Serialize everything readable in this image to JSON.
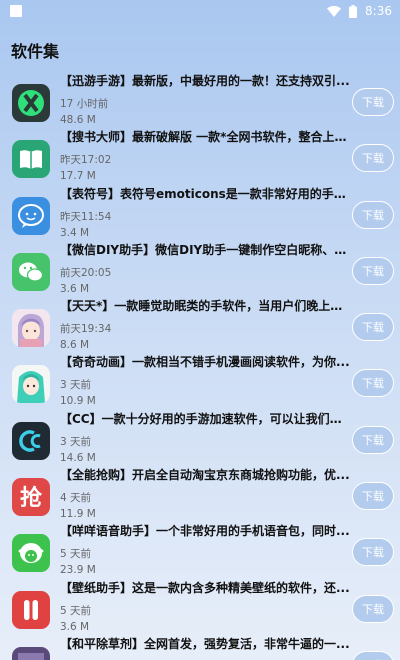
{
  "status_bar": {
    "time": "8:36"
  },
  "page": {
    "title": "软件集"
  },
  "download_label": "下载",
  "apps": [
    {
      "title": "【迅游手游】最新版，中最好用的一款！还支持双引...",
      "time": "17 小时前",
      "size": "48.6 M",
      "icon": "xunyou-app-icon"
    },
    {
      "title": "【搜书大师】最新破解版 一款*全网书软件，整合上百...",
      "time": "昨天17:02",
      "size": "17.7 M",
      "icon": "book-app-icon"
    },
    {
      "title": "【表符号】表符号emoticons是一款非常好用的手表符...",
      "time": "昨天11:54",
      "size": "3.4 M",
      "icon": "chat-bubble-app-icon"
    },
    {
      "title": "【微信DIY助手】微信DIY助手一键制作空白昵称、头...",
      "time": "前天20:05",
      "size": "3.6 M",
      "icon": "wechat-app-icon"
    },
    {
      "title": "【天天*】一款睡觉助眠类的手软件，当用户们晚上翻...",
      "time": "前天19:34",
      "size": "8.6 M",
      "icon": "anime-girl-app-icon"
    },
    {
      "title": "【奇奇动画】一款相当不错手机漫画阅读软件，为你...",
      "time": "3 天前",
      "size": "10.9 M",
      "icon": "green-hair-app-icon"
    },
    {
      "title": "【CC】一款十分好用的手游加速软件，可以让我们用...",
      "time": "3 天前",
      "size": "14.6 M",
      "icon": "cc-app-icon"
    },
    {
      "title": "【全能抢购】开启全自动淘宝京东商城抢购功能，优...",
      "time": "4 天前",
      "size": "11.9 M",
      "icon": "qiang-app-icon"
    },
    {
      "title": "【咩咩语音助手】一个非常好用的手机语音包，同时...",
      "time": "5 天前",
      "size": "23.9 M",
      "icon": "sheep-app-icon"
    },
    {
      "title": "【壁纸助手】这是一款内含多种精美壁纸的软件，还...",
      "time": "5 天前",
      "size": "3.6 M",
      "icon": "wallpaper-app-icon"
    },
    {
      "title": "【和平除草剂】全网首发，强势复活，非常牛逼的一...",
      "time": "",
      "size": "",
      "icon": "game-app-icon"
    }
  ]
}
